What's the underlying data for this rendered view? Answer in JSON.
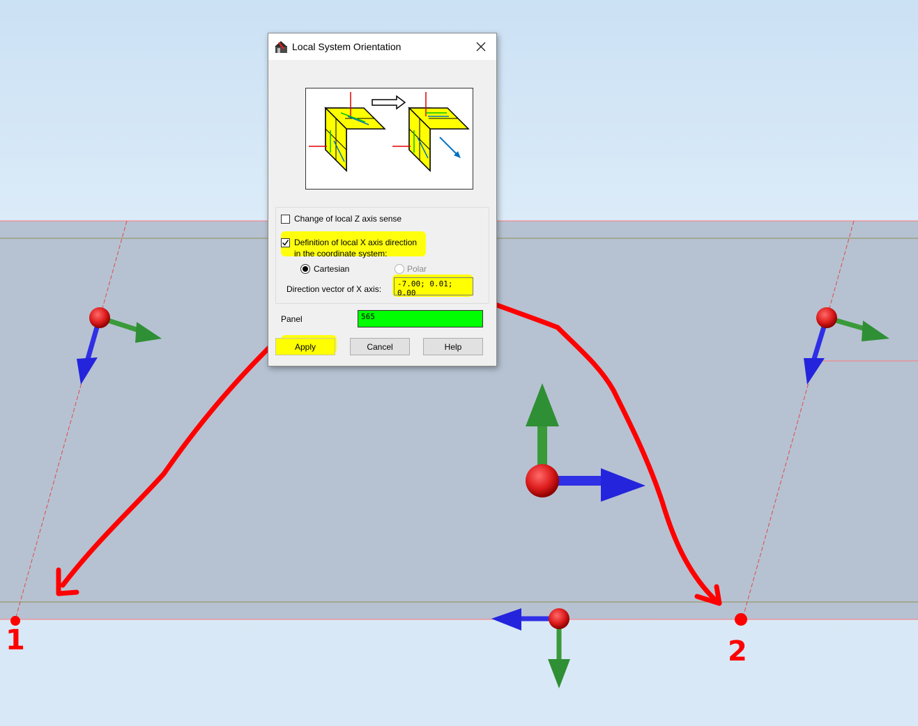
{
  "dialog": {
    "title": "Local System Orientation",
    "change_z_label": "Change of local Z axis sense",
    "change_z_checked": false,
    "def_x_label_line1": "Definition of local X axis direction",
    "def_x_label_line2": "in the coordinate system:",
    "def_x_checked": true,
    "cartesian_label": "Cartesian",
    "polar_label": "Polar",
    "selected_system": "Cartesian",
    "direction_label": "Direction vector of X axis:",
    "direction_value": "-7.00; 0.01; 0.00",
    "panel_label": "Panel",
    "panel_value": "565",
    "apply_label": "Apply",
    "cancel_label": "Cancel",
    "help_label": "Help"
  },
  "annotations": {
    "marker_1": "1",
    "marker_2": "2"
  },
  "colors": {
    "highlight": "#ffff00",
    "panel_field": "#00ff00",
    "annotation": "#ff0000",
    "slab": "#b8c4d4"
  }
}
